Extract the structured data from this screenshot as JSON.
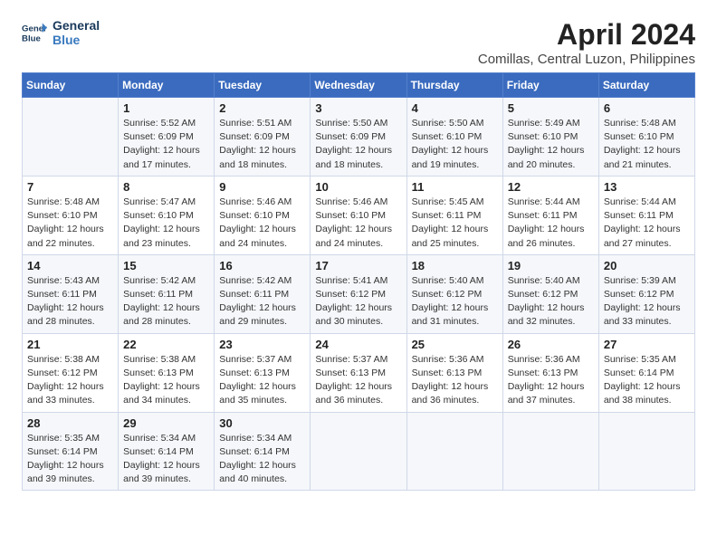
{
  "header": {
    "logo_line1": "General",
    "logo_line2": "Blue",
    "month": "April 2024",
    "location": "Comillas, Central Luzon, Philippines"
  },
  "weekdays": [
    "Sunday",
    "Monday",
    "Tuesday",
    "Wednesday",
    "Thursday",
    "Friday",
    "Saturday"
  ],
  "weeks": [
    [
      {
        "day": "",
        "sunrise": "",
        "sunset": "",
        "daylight": ""
      },
      {
        "day": "1",
        "sunrise": "Sunrise: 5:52 AM",
        "sunset": "Sunset: 6:09 PM",
        "daylight": "Daylight: 12 hours and 17 minutes."
      },
      {
        "day": "2",
        "sunrise": "Sunrise: 5:51 AM",
        "sunset": "Sunset: 6:09 PM",
        "daylight": "Daylight: 12 hours and 18 minutes."
      },
      {
        "day": "3",
        "sunrise": "Sunrise: 5:50 AM",
        "sunset": "Sunset: 6:09 PM",
        "daylight": "Daylight: 12 hours and 18 minutes."
      },
      {
        "day": "4",
        "sunrise": "Sunrise: 5:50 AM",
        "sunset": "Sunset: 6:10 PM",
        "daylight": "Daylight: 12 hours and 19 minutes."
      },
      {
        "day": "5",
        "sunrise": "Sunrise: 5:49 AM",
        "sunset": "Sunset: 6:10 PM",
        "daylight": "Daylight: 12 hours and 20 minutes."
      },
      {
        "day": "6",
        "sunrise": "Sunrise: 5:48 AM",
        "sunset": "Sunset: 6:10 PM",
        "daylight": "Daylight: 12 hours and 21 minutes."
      }
    ],
    [
      {
        "day": "7",
        "sunrise": "Sunrise: 5:48 AM",
        "sunset": "Sunset: 6:10 PM",
        "daylight": "Daylight: 12 hours and 22 minutes."
      },
      {
        "day": "8",
        "sunrise": "Sunrise: 5:47 AM",
        "sunset": "Sunset: 6:10 PM",
        "daylight": "Daylight: 12 hours and 23 minutes."
      },
      {
        "day": "9",
        "sunrise": "Sunrise: 5:46 AM",
        "sunset": "Sunset: 6:10 PM",
        "daylight": "Daylight: 12 hours and 24 minutes."
      },
      {
        "day": "10",
        "sunrise": "Sunrise: 5:46 AM",
        "sunset": "Sunset: 6:10 PM",
        "daylight": "Daylight: 12 hours and 24 minutes."
      },
      {
        "day": "11",
        "sunrise": "Sunrise: 5:45 AM",
        "sunset": "Sunset: 6:11 PM",
        "daylight": "Daylight: 12 hours and 25 minutes."
      },
      {
        "day": "12",
        "sunrise": "Sunrise: 5:44 AM",
        "sunset": "Sunset: 6:11 PM",
        "daylight": "Daylight: 12 hours and 26 minutes."
      },
      {
        "day": "13",
        "sunrise": "Sunrise: 5:44 AM",
        "sunset": "Sunset: 6:11 PM",
        "daylight": "Daylight: 12 hours and 27 minutes."
      }
    ],
    [
      {
        "day": "14",
        "sunrise": "Sunrise: 5:43 AM",
        "sunset": "Sunset: 6:11 PM",
        "daylight": "Daylight: 12 hours and 28 minutes."
      },
      {
        "day": "15",
        "sunrise": "Sunrise: 5:42 AM",
        "sunset": "Sunset: 6:11 PM",
        "daylight": "Daylight: 12 hours and 28 minutes."
      },
      {
        "day": "16",
        "sunrise": "Sunrise: 5:42 AM",
        "sunset": "Sunset: 6:11 PM",
        "daylight": "Daylight: 12 hours and 29 minutes."
      },
      {
        "day": "17",
        "sunrise": "Sunrise: 5:41 AM",
        "sunset": "Sunset: 6:12 PM",
        "daylight": "Daylight: 12 hours and 30 minutes."
      },
      {
        "day": "18",
        "sunrise": "Sunrise: 5:40 AM",
        "sunset": "Sunset: 6:12 PM",
        "daylight": "Daylight: 12 hours and 31 minutes."
      },
      {
        "day": "19",
        "sunrise": "Sunrise: 5:40 AM",
        "sunset": "Sunset: 6:12 PM",
        "daylight": "Daylight: 12 hours and 32 minutes."
      },
      {
        "day": "20",
        "sunrise": "Sunrise: 5:39 AM",
        "sunset": "Sunset: 6:12 PM",
        "daylight": "Daylight: 12 hours and 33 minutes."
      }
    ],
    [
      {
        "day": "21",
        "sunrise": "Sunrise: 5:38 AM",
        "sunset": "Sunset: 6:12 PM",
        "daylight": "Daylight: 12 hours and 33 minutes."
      },
      {
        "day": "22",
        "sunrise": "Sunrise: 5:38 AM",
        "sunset": "Sunset: 6:13 PM",
        "daylight": "Daylight: 12 hours and 34 minutes."
      },
      {
        "day": "23",
        "sunrise": "Sunrise: 5:37 AM",
        "sunset": "Sunset: 6:13 PM",
        "daylight": "Daylight: 12 hours and 35 minutes."
      },
      {
        "day": "24",
        "sunrise": "Sunrise: 5:37 AM",
        "sunset": "Sunset: 6:13 PM",
        "daylight": "Daylight: 12 hours and 36 minutes."
      },
      {
        "day": "25",
        "sunrise": "Sunrise: 5:36 AM",
        "sunset": "Sunset: 6:13 PM",
        "daylight": "Daylight: 12 hours and 36 minutes."
      },
      {
        "day": "26",
        "sunrise": "Sunrise: 5:36 AM",
        "sunset": "Sunset: 6:13 PM",
        "daylight": "Daylight: 12 hours and 37 minutes."
      },
      {
        "day": "27",
        "sunrise": "Sunrise: 5:35 AM",
        "sunset": "Sunset: 6:14 PM",
        "daylight": "Daylight: 12 hours and 38 minutes."
      }
    ],
    [
      {
        "day": "28",
        "sunrise": "Sunrise: 5:35 AM",
        "sunset": "Sunset: 6:14 PM",
        "daylight": "Daylight: 12 hours and 39 minutes."
      },
      {
        "day": "29",
        "sunrise": "Sunrise: 5:34 AM",
        "sunset": "Sunset: 6:14 PM",
        "daylight": "Daylight: 12 hours and 39 minutes."
      },
      {
        "day": "30",
        "sunrise": "Sunrise: 5:34 AM",
        "sunset": "Sunset: 6:14 PM",
        "daylight": "Daylight: 12 hours and 40 minutes."
      },
      {
        "day": "",
        "sunrise": "",
        "sunset": "",
        "daylight": ""
      },
      {
        "day": "",
        "sunrise": "",
        "sunset": "",
        "daylight": ""
      },
      {
        "day": "",
        "sunrise": "",
        "sunset": "",
        "daylight": ""
      },
      {
        "day": "",
        "sunrise": "",
        "sunset": "",
        "daylight": ""
      }
    ]
  ]
}
